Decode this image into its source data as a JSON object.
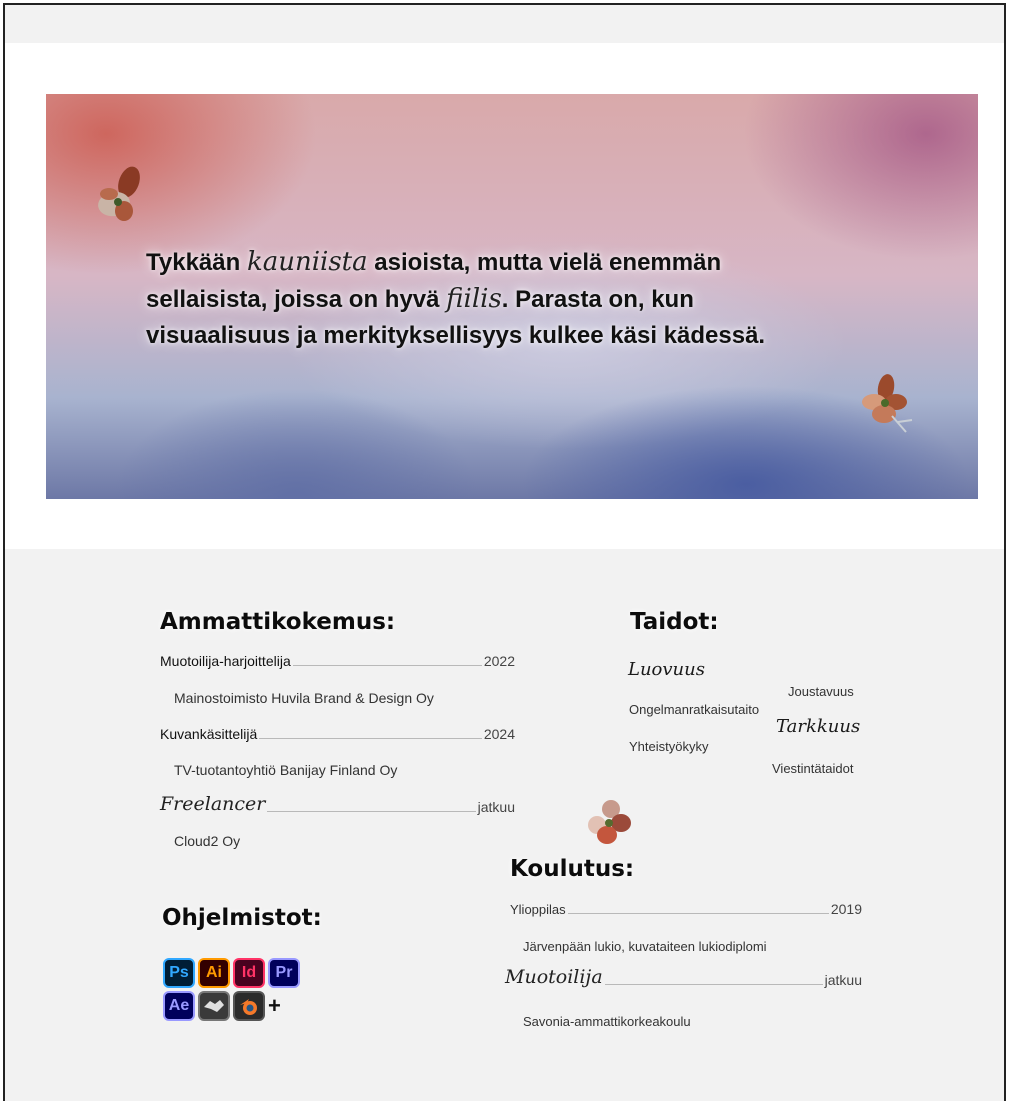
{
  "hero": {
    "line1_a": "Tykkään ",
    "line1_script": "kauniista",
    "line1_b": " asioista, mutta vielä enemmän",
    "line2_a": "sellaisista, joissa on hyvä ",
    "line2_script": "fiilis",
    "line2_b": ". Parasta on, kun",
    "line3": "visuaalisuus ja merkityksellisyys kulkee käsi kädessä."
  },
  "experience": {
    "title": "Ammattikokemus:",
    "items": [
      {
        "role": "Muotoilija-harjoittelija",
        "year": "2022",
        "company": "Mainostoimisto Huvila Brand & Design Oy"
      },
      {
        "role": "Kuvankäsittelijä",
        "year": "2024",
        "company": "TV-tuotantoyhtiö Banijay Finland Oy"
      },
      {
        "role": "Freelancer",
        "year": "jatkuu",
        "company": "Cloud2 Oy"
      }
    ]
  },
  "skills": {
    "title": "Taidot:",
    "luovuus": "Luovuus",
    "joustavuus": "Joustavuus",
    "ongelmanratkaisu": "Ongelmanratkaisutaito",
    "tarkkuus": "Tarkkuus",
    "yhteistyo": "Yhteistyökyky",
    "viestinta": "Viestintätaidot"
  },
  "software": {
    "title": "Ohjelmistot:",
    "tools": [
      {
        "abbr": "Ps",
        "icon": "photoshop-icon",
        "bg": "#001e36",
        "fg": "#31a8ff"
      },
      {
        "abbr": "Ai",
        "icon": "illustrator-icon",
        "bg": "#330000",
        "fg": "#ff9a00"
      },
      {
        "abbr": "Id",
        "icon": "indesign-icon",
        "bg": "#49021f",
        "fg": "#ff3366"
      },
      {
        "abbr": "Pr",
        "icon": "premiere-icon",
        "bg": "#00005b",
        "fg": "#9999ff"
      },
      {
        "abbr": "Ae",
        "icon": "after-effects-icon",
        "bg": "#00005b",
        "fg": "#9999ff"
      }
    ],
    "plus": "+"
  },
  "education": {
    "title": "Koulutus:",
    "items": [
      {
        "degree": "Ylioppilas",
        "year": "2019",
        "school": "Järvenpään lukio, kuvataiteen lukiodiplomi"
      },
      {
        "degree": "Muotoilija",
        "year": "jatkuu",
        "school": "Savonia-ammattikorkeakoulu"
      }
    ]
  }
}
